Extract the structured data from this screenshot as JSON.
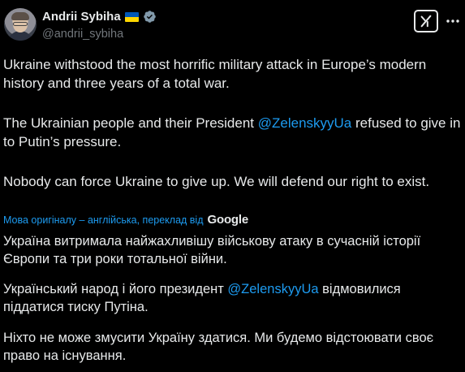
{
  "author": {
    "name": "Andrii Sybiha",
    "handle": "@andrii_sybiha",
    "flag": "ukraine-flag",
    "verified": "verified-badge-icon"
  },
  "actions": {
    "grok_icon": "grok-icon",
    "more_icon": "more-icon"
  },
  "post": {
    "p1": "Ukraine withstood the most horrific military attack in Europe’s modern history and three years of a total war.",
    "p2_before": "The Ukrainian people and their President ",
    "p2_mention": "@ZelenskyyUa",
    "p2_after": " refused to give in to Putin’s pressure.",
    "p3": "Nobody can force Ukraine to give up. We will defend our right to exist."
  },
  "translation": {
    "note": "Мова оригіналу – англійська, переклад від",
    "provider": "Google",
    "p1": "Україна витримала найжахливішу військову атаку в сучасній історії Європи та три роки тотальної війни.",
    "p2_before": "Український народ і його президент ",
    "p2_mention": "@ZelenskyyUa",
    "p2_after": " відмовилися піддатися тиску Путіна.",
    "p3": "Ніхто не може змусити Україну здатися. Ми будемо відстоювати своє право на існування."
  },
  "colors": {
    "background": "#000000",
    "text": "#e7e9ea",
    "secondary": "#71767b",
    "link": "#1d9bf0",
    "verified": "#829aab"
  }
}
